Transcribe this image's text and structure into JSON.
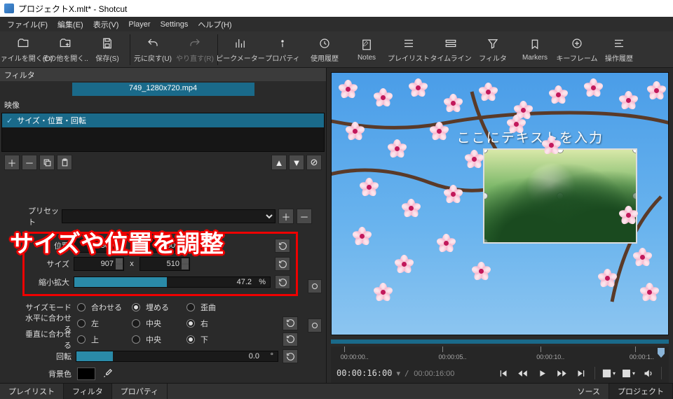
{
  "title": "プロジェクトX.mlt* - Shotcut",
  "menu": {
    "file": "ファイル(F)",
    "edit": "編集(E)",
    "view": "表示(V)",
    "player": "Player",
    "settings": "Settings",
    "help": "ヘルプ(H)"
  },
  "toolbar": {
    "open": "ファイルを開く(O)",
    "openother": "その他を開く..",
    "save": "保存(S)",
    "undo": "元に戻す(U)",
    "redo": "やり直す(R)",
    "peak": "ピークメーター",
    "props": "プロパティ",
    "recent": "使用履歴",
    "notes": "Notes",
    "playlist": "プレイリスト",
    "timeline": "タイムライン",
    "filters": "フィルタ",
    "markers": "Markers",
    "keyframes": "キーフレーム",
    "history": "操作履歴"
  },
  "filters": {
    "header": "フィルタ",
    "clip": "749_1280x720.mp4",
    "category": "映像",
    "item": "サイズ・位置・回転",
    "preset_label": "プリセット",
    "pos_label": "位置",
    "pos_x": "800",
    "pos_y": "500",
    "size_label": "サイズ",
    "size_w": "907",
    "size_h": "510",
    "zoom_label": "縮小拡大",
    "zoom_val": "47.2",
    "zoom_unit": "%",
    "sizemode_label": "サイズモード",
    "sm_fit": "合わせる",
    "sm_fill": "埋める",
    "sm_distort": "歪曲",
    "halign_label": "水平に合わせる",
    "ha_l": "左",
    "ha_c": "中央",
    "ha_r": "右",
    "valign_label": "垂直に合わせる",
    "va_t": "上",
    "va_c": "中央",
    "va_b": "下",
    "rot_label": "回転",
    "rot_val": "0.0",
    "rot_unit": "°",
    "bg_label": "背景色"
  },
  "annotation": "サイズや位置を調整",
  "preview": {
    "overlay_text": "ここにテキストを入力"
  },
  "ruler": {
    "t0": "00:00:00..",
    "t1": "00:00:05..",
    "t2": "00:00:10..",
    "t3": "00:00:1.."
  },
  "transport": {
    "cur": "00:00:16:00",
    "dur": "00:00:16:00"
  },
  "bottomtabs": {
    "playlist": "プレイリスト",
    "filters": "フィルタ",
    "props": "プロパティ",
    "source": "ソース",
    "project": "プロジェクト"
  }
}
